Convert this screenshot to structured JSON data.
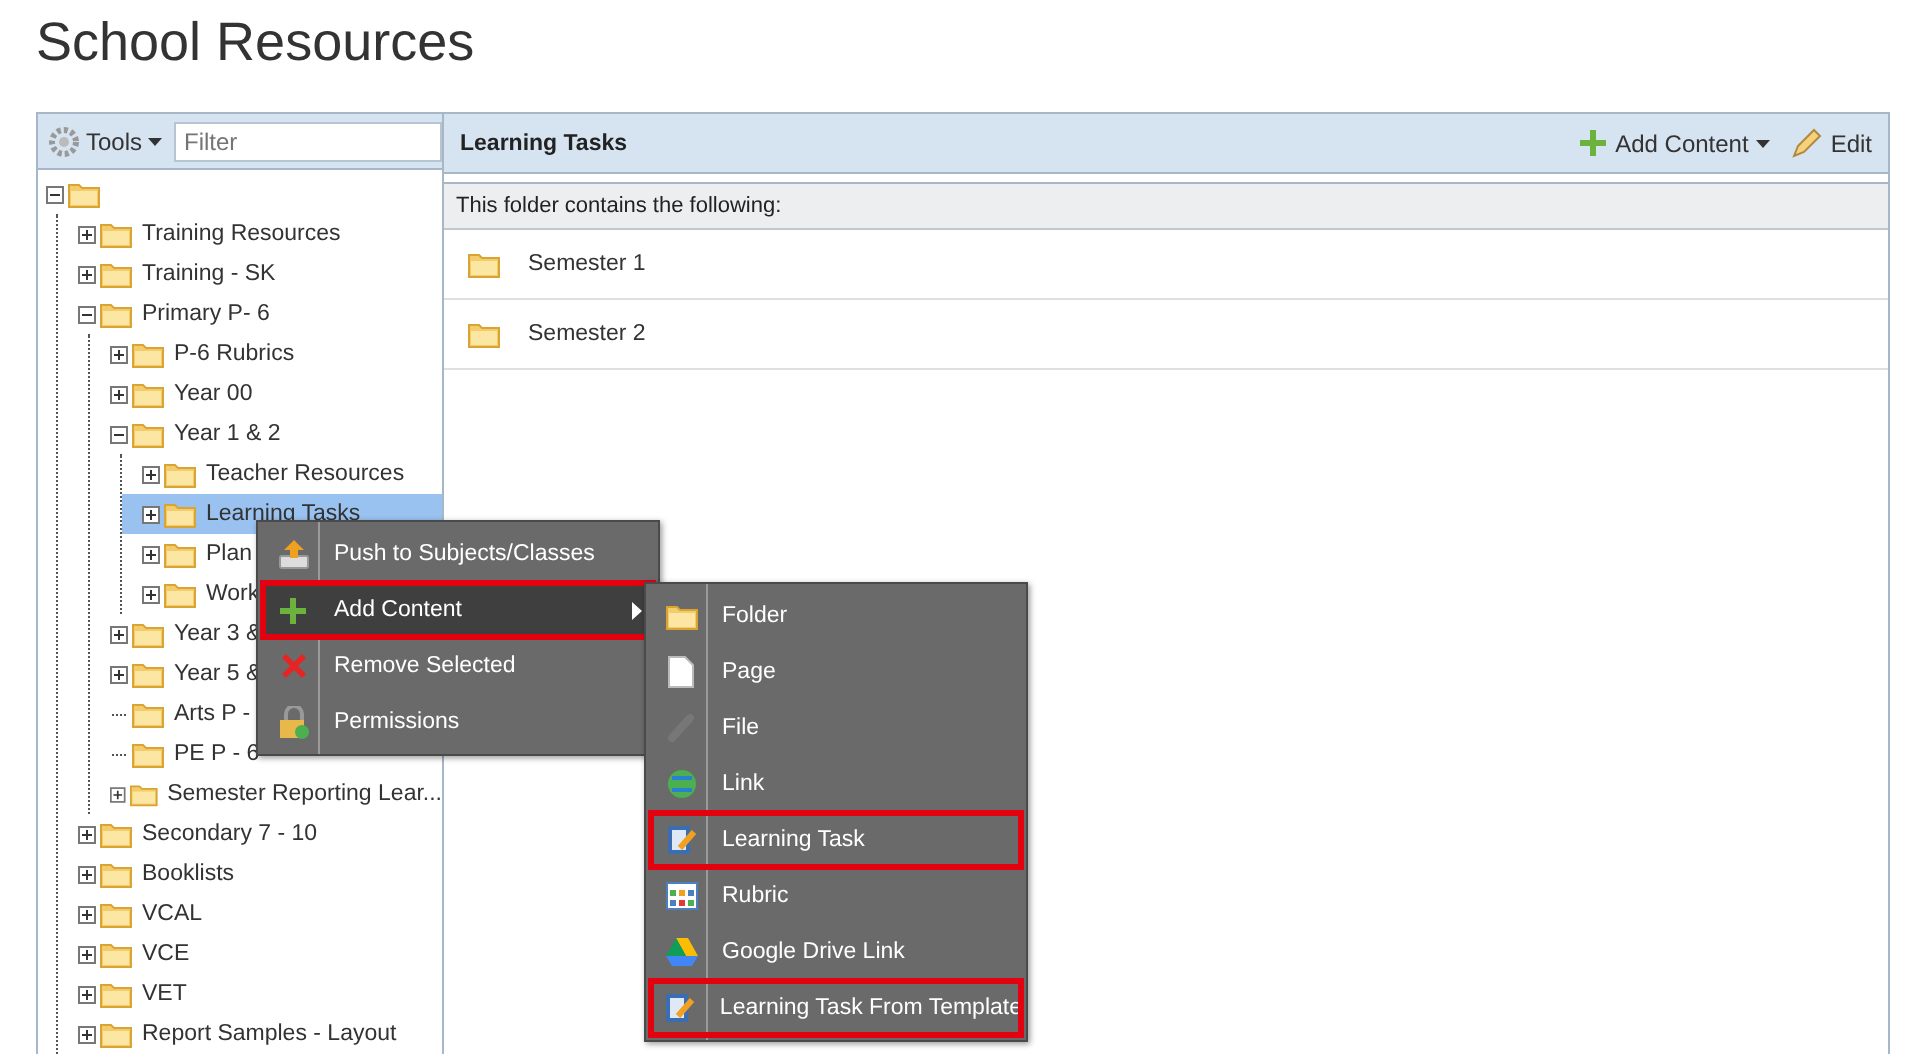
{
  "page_title": "School Resources",
  "sidebar": {
    "tools_label": "Tools",
    "filter_placeholder": "Filter",
    "tree": [
      {
        "kind": "branch",
        "expanded": true,
        "selected": false,
        "children": [
          {
            "kind": "branch",
            "label": "Training Resources",
            "expanded": false,
            "selected": false
          },
          {
            "kind": "branch",
            "label": "Training - SK",
            "expanded": false,
            "selected": false
          },
          {
            "kind": "branch",
            "label": "Primary P- 6",
            "expanded": true,
            "selected": false,
            "children": [
              {
                "kind": "branch",
                "label": "P-6 Rubrics",
                "expanded": false,
                "selected": false
              },
              {
                "kind": "branch",
                "label": "Year 00",
                "expanded": false,
                "selected": false
              },
              {
                "kind": "branch",
                "label": "Year 1 & 2",
                "expanded": true,
                "selected": false,
                "children": [
                  {
                    "kind": "branch",
                    "label": "Teacher Resources",
                    "expanded": false,
                    "selected": false
                  },
                  {
                    "kind": "branch",
                    "label": "Learning Tasks",
                    "expanded": false,
                    "selected": true
                  },
                  {
                    "kind": "branch",
                    "label": "Plan",
                    "expanded": false,
                    "selected": false
                  },
                  {
                    "kind": "branch",
                    "label": "Work",
                    "expanded": false,
                    "selected": false
                  }
                ]
              },
              {
                "kind": "branch",
                "label": "Year 3 &",
                "expanded": false,
                "selected": false
              },
              {
                "kind": "branch",
                "label": "Year 5 &",
                "expanded": false,
                "selected": false
              },
              {
                "kind": "leaf",
                "label": "Arts P -",
                "selected": false
              },
              {
                "kind": "leaf",
                "label": "PE P - 6",
                "selected": false
              },
              {
                "kind": "branch",
                "label": "Semester Reporting Lear...",
                "expanded": false,
                "selected": false
              }
            ]
          },
          {
            "kind": "branch",
            "label": "Secondary 7 - 10",
            "expanded": false,
            "selected": false
          },
          {
            "kind": "branch",
            "label": "Booklists",
            "expanded": false,
            "selected": false
          },
          {
            "kind": "branch",
            "label": "VCAL",
            "expanded": false,
            "selected": false
          },
          {
            "kind": "branch",
            "label": "VCE",
            "expanded": false,
            "selected": false
          },
          {
            "kind": "branch",
            "label": "VET",
            "expanded": false,
            "selected": false
          },
          {
            "kind": "branch",
            "label": "Report Samples - Layout",
            "expanded": false,
            "selected": false
          }
        ]
      }
    ]
  },
  "content": {
    "title": "Learning Tasks",
    "actions": [
      {
        "kind": "add",
        "label": "Add Content"
      },
      {
        "kind": "edit",
        "label": "Edit"
      }
    ],
    "notice": "This folder contains the following:",
    "items": [
      {
        "label": "Semester 1"
      },
      {
        "label": "Semester 2"
      }
    ]
  },
  "context_menu": {
    "items": [
      {
        "kind": "push",
        "label": "Push to Subjects/Classes",
        "active": false,
        "outlined": false
      },
      {
        "kind": "add",
        "label": "Add Content",
        "active": true,
        "outlined": true,
        "submenu": true
      },
      {
        "kind": "remove",
        "label": "Remove Selected",
        "active": false,
        "outlined": false
      },
      {
        "kind": "permissions",
        "label": "Permissions",
        "active": false,
        "outlined": false
      }
    ]
  },
  "submenu": {
    "items": [
      {
        "kind": "folder",
        "label": "Folder",
        "outlined": false
      },
      {
        "kind": "page",
        "label": "Page",
        "outlined": false
      },
      {
        "kind": "file",
        "label": "File",
        "outlined": false
      },
      {
        "kind": "link",
        "label": "Link",
        "outlined": false
      },
      {
        "kind": "task",
        "label": "Learning Task",
        "outlined": true
      },
      {
        "kind": "rubric",
        "label": "Rubric",
        "outlined": false
      },
      {
        "kind": "drive",
        "label": "Google Drive Link",
        "outlined": false
      },
      {
        "kind": "task",
        "label": "Learning Task From Template",
        "outlined": true
      }
    ]
  }
}
